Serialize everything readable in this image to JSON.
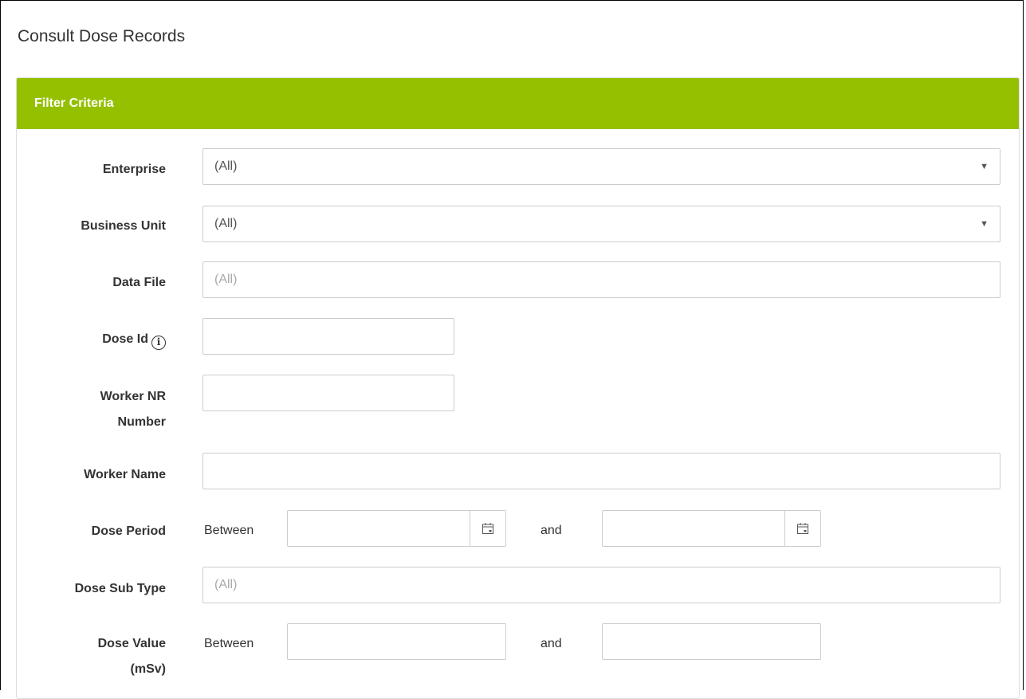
{
  "page": {
    "title": "Consult Dose Records"
  },
  "panel": {
    "header": "Filter Criteria"
  },
  "colors": {
    "panel_header_bg": "#94c000",
    "panel_header_text": "#ffffff",
    "border": "#cccccc"
  },
  "fields": {
    "enterprise": {
      "label": "Enterprise",
      "value": "(All)"
    },
    "business_unit": {
      "label": "Business Unit",
      "value": "(All)"
    },
    "data_file": {
      "label": "Data File",
      "placeholder": "(All)"
    },
    "dose_id": {
      "label": "Dose Id",
      "value": "",
      "info_icon": "info-circle-icon"
    },
    "worker_nr": {
      "label_line1": "Worker NR",
      "label_line2": "Number",
      "value": ""
    },
    "worker_name": {
      "label": "Worker Name",
      "value": ""
    },
    "dose_period": {
      "label": "Dose Period",
      "between": "Between",
      "and": "and",
      "from": "",
      "to": "",
      "icon": "calendar-icon"
    },
    "dose_sub_type": {
      "label": "Dose Sub Type",
      "placeholder": "(All)"
    },
    "dose_value": {
      "label_line1": "Dose Value",
      "label_line2": "(mSv)",
      "between": "Between",
      "and": "and",
      "from": "",
      "to": ""
    }
  }
}
